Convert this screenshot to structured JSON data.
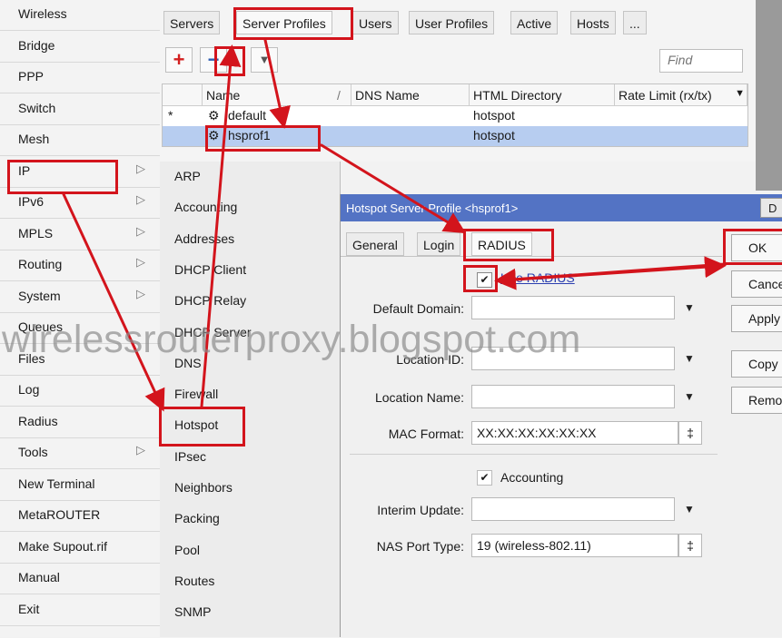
{
  "left_menu": [
    {
      "label": "Wireless",
      "submenu": false
    },
    {
      "label": "Bridge",
      "submenu": false
    },
    {
      "label": "PPP",
      "submenu": false
    },
    {
      "label": "Switch",
      "submenu": false
    },
    {
      "label": "Mesh",
      "submenu": false
    },
    {
      "label": "IP",
      "submenu": true
    },
    {
      "label": "IPv6",
      "submenu": true
    },
    {
      "label": "MPLS",
      "submenu": true
    },
    {
      "label": "Routing",
      "submenu": true
    },
    {
      "label": "System",
      "submenu": true
    },
    {
      "label": "Queues",
      "submenu": false
    },
    {
      "label": "Files",
      "submenu": false
    },
    {
      "label": "Log",
      "submenu": false
    },
    {
      "label": "Radius",
      "submenu": false
    },
    {
      "label": "Tools",
      "submenu": true
    },
    {
      "label": "New Terminal",
      "submenu": false
    },
    {
      "label": "MetaROUTER",
      "submenu": false
    },
    {
      "label": "Make Supout.rif",
      "submenu": false
    },
    {
      "label": "Manual",
      "submenu": false
    },
    {
      "label": "Exit",
      "submenu": false
    }
  ],
  "submenu_arrow": "▷",
  "ip_submenu": [
    "ARP",
    "Accounting",
    "Addresses",
    "DHCP Client",
    "DHCP Relay",
    "DHCP Server",
    "DNS",
    "Firewall",
    "Hotspot",
    "IPsec",
    "Neighbors",
    "Packing",
    "Pool",
    "Routes",
    "SNMP"
  ],
  "hotspot_window": {
    "tabs": [
      "Servers",
      "Server Profiles",
      "Users",
      "User Profiles",
      "Active",
      "Hosts",
      "..."
    ],
    "find_placeholder": "Find",
    "toolbar": {
      "add": "+",
      "remove": "−",
      "filter": "▼"
    },
    "columns": [
      "Name",
      "DNS Name",
      "HTML Directory",
      "Rate Limit (rx/tx)"
    ],
    "sort_indicator": "/",
    "column_menu": "▼",
    "rows": [
      {
        "marker": "*",
        "name": "default",
        "dns": "",
        "html_dir": "hotspot",
        "rate": ""
      },
      {
        "marker": "",
        "name": "hsprof1",
        "dns": "",
        "html_dir": "hotspot",
        "rate": ""
      }
    ]
  },
  "dialog": {
    "title": "Hotspot Server Profile <hsprof1>",
    "title_button": "D",
    "tabs": [
      "General",
      "Login",
      "RADIUS"
    ],
    "use_radius_label": "Use RADIUS",
    "use_radius_checked": true,
    "fields": [
      {
        "label": "Default Domain:",
        "value": "",
        "control": "▼"
      },
      {
        "label": "Location ID:",
        "value": "",
        "control": "▼"
      },
      {
        "label": "Location Name:",
        "value": "",
        "control": "▼"
      },
      {
        "label": "MAC Format:",
        "value": "XX:XX:XX:XX:XX:XX",
        "control": "‡"
      }
    ],
    "accounting_label": "Accounting",
    "accounting_checked": true,
    "fields2": [
      {
        "label": "Interim Update:",
        "value": "",
        "control": "▼"
      },
      {
        "label": "NAS Port Type:",
        "value": "19 (wireless-802.11)",
        "control": "‡"
      }
    ],
    "buttons": [
      "OK",
      "Cancel",
      "Apply",
      "Copy",
      "Remove"
    ],
    "check_mark": "✔"
  },
  "watermark": "wirelessrouterproxy.blogspot.com",
  "colors": {
    "title_bar": "#5373c4",
    "selection": "#b7cdf0",
    "highlight": "#d3141c",
    "add_icon": "#d32020",
    "remove_icon": "#2f5fb3"
  }
}
